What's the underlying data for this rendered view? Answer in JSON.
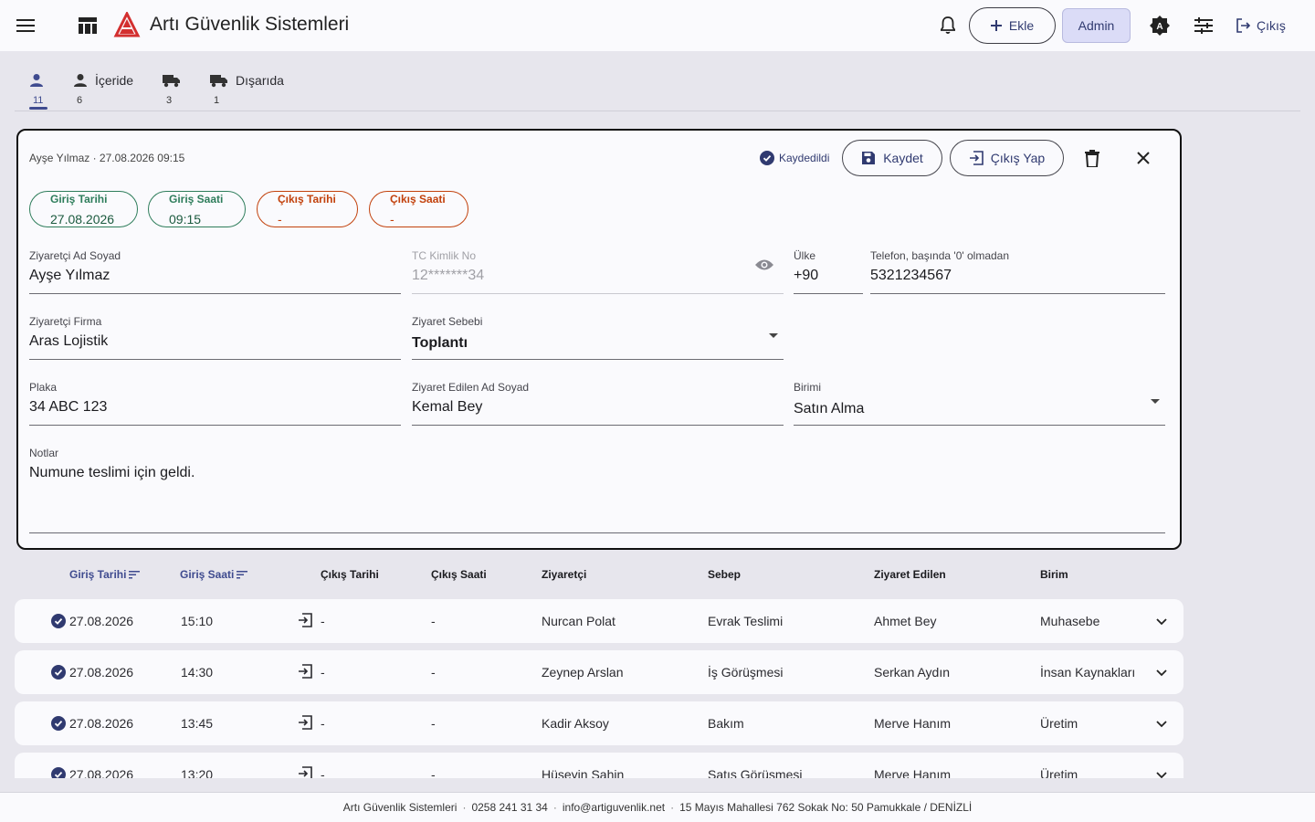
{
  "header": {
    "title": "Artı Güvenlik Sistemleri",
    "add_label": "Ekle",
    "admin_label": "Admin",
    "logout_label": "Çıkış",
    "accent": "#303a70",
    "logo_color": "#d32f2f"
  },
  "tabs": [
    {
      "label": "",
      "count": "11",
      "icon": "person-icon",
      "active": true
    },
    {
      "label": "İçeride",
      "count": "6",
      "icon": "person-icon"
    },
    {
      "label": "",
      "count": "3",
      "icon": "truck-icon"
    },
    {
      "label": "Dışarıda",
      "count": "1",
      "icon": "truck-icon"
    }
  ],
  "form": {
    "meta": "Ayşe Yılmaz · 27.08.2026 09:15",
    "saved_label": "Kaydedildi",
    "save_label": "Kaydet",
    "exit_label": "Çıkış Yap",
    "entry_date": {
      "label": "Giriş Tarihi",
      "value": "27.08.2026"
    },
    "entry_time": {
      "label": "Giriş Saati",
      "value": "09:15"
    },
    "exit_date": {
      "label": "Çıkış Tarihi",
      "value": "-"
    },
    "exit_time": {
      "label": "Çıkış Saati",
      "value": "-"
    },
    "visitor_name": {
      "label": "Ziyaretçi Ad Soyad",
      "value": "Ayşe Yılmaz"
    },
    "tc_no": {
      "label": "TC Kimlik No",
      "value": "12*******34"
    },
    "country": {
      "label": "Ülke",
      "value": "+90"
    },
    "phone": {
      "label": "Telefon, başında '0' olmadan",
      "value": "5321234567"
    },
    "company": {
      "label": "Ziyaretçi Firma",
      "value": "Aras Lojistik"
    },
    "reason": {
      "label": "Ziyaret Sebebi",
      "value": "Toplantı"
    },
    "plate": {
      "label": "Plaka",
      "value": "34 ABC 123"
    },
    "host": {
      "label": "Ziyaret Edilen Ad Soyad",
      "value": "Kemal Bey"
    },
    "department": {
      "label": "Birimi",
      "value": "Satın Alma"
    },
    "notes": {
      "label": "Notlar",
      "value": "Numune teslimi için geldi."
    }
  },
  "table": {
    "headers": {
      "entry_date": "Giriş Tarihi",
      "entry_time": "Giriş Saati",
      "exit_date": "Çıkış Tarihi",
      "exit_time": "Çıkış Saati",
      "visitor": "Ziyaretçi",
      "reason": "Sebep",
      "host": "Ziyaret Edilen",
      "department": "Birim"
    },
    "rows": [
      {
        "entry_date": "27.08.2026",
        "entry_time": "15:10",
        "exit_date": "-",
        "exit_time": "-",
        "visitor": "Nurcan Polat",
        "reason": "Evrak Teslimi",
        "host": "Ahmet Bey",
        "department": "Muhasebe"
      },
      {
        "entry_date": "27.08.2026",
        "entry_time": "14:30",
        "exit_date": "-",
        "exit_time": "-",
        "visitor": "Zeynep Arslan",
        "reason": "İş Görüşmesi",
        "host": "Serkan Aydın",
        "department": "İnsan Kaynakları"
      },
      {
        "entry_date": "27.08.2026",
        "entry_time": "13:45",
        "exit_date": "-",
        "exit_time": "-",
        "visitor": "Kadir Aksoy",
        "reason": "Bakım",
        "host": "Merve Hanım",
        "department": "Üretim"
      },
      {
        "entry_date": "27.08.2026",
        "entry_time": "13:20",
        "exit_date": "-",
        "exit_time": "-",
        "visitor": "Hüseyin Şahin",
        "reason": "Satış Görüşmesi",
        "host": "Merve Hanım",
        "department": "Üretim"
      }
    ]
  },
  "footer": {
    "company": "Artı Güvenlik Sistemleri",
    "phone": "0258 241 31 34",
    "email": "info@artiguvenlik.net",
    "address": "15 Mayıs Mahallesi 762 Sokak No: 50 Pamukkale / DENİZLİ"
  }
}
